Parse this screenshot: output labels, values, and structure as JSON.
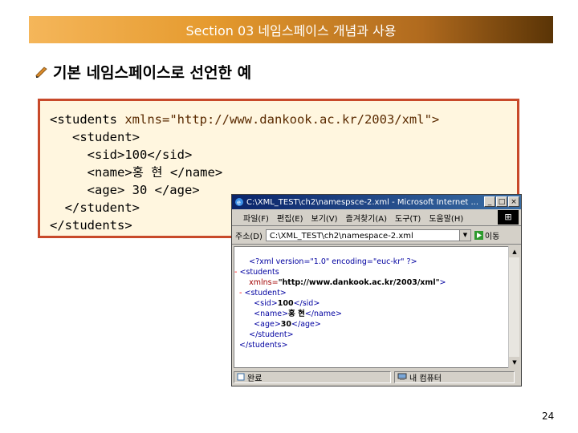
{
  "slide": {
    "title": "Section 03 네임스페이스 개념과 사용",
    "heading": "기본 네임스페이스로 선언한 예",
    "page_number": "24"
  },
  "code": {
    "line1_tag": "<students ",
    "line1_attr": "xmlns=\"http://www.dankook.ac.kr/2003/xml\">",
    "line2": "   <student>",
    "line3": "     <sid>100</sid>",
    "line4": "     <name>홍 현 </name>",
    "line5": "     <age> 30 </age>",
    "line6": "  </student>",
    "line7": "</students>"
  },
  "browser": {
    "window_title": "C:\\XML_TEST\\ch2\\namespsce-2.xml - Microsoft Internet ...",
    "menu": [
      "파일(F)",
      "편집(E)",
      "보기(V)",
      "즐겨찾기(A)",
      "도구(T)",
      "도움말(H)"
    ],
    "address_label": "주소(D)",
    "address_value": "C:\\XML_TEST\\ch2\\namespace-2.xml",
    "go_label": "이동",
    "xml_decl": "<?xml version=\"1.0\" encoding=\"euc-kr\" ?>",
    "students_open": "<students",
    "xmlns_attr": "xmlns=",
    "xmlns_value": "\"http://www.dankook.ac.kr/2003/xml\"",
    "student_open": "<student>",
    "sid_open": "<sid>",
    "sid_value": "100",
    "sid_close": "</sid>",
    "name_open": "<name>",
    "name_value": "홍 현",
    "name_close": "</name>",
    "age_open": "<age>",
    "age_value": "30",
    "age_close": "</age>",
    "student_close": "</student>",
    "students_close": "</students>",
    "minus": "-",
    "status_left": "완료",
    "status_right": "내 컴퓨터"
  }
}
